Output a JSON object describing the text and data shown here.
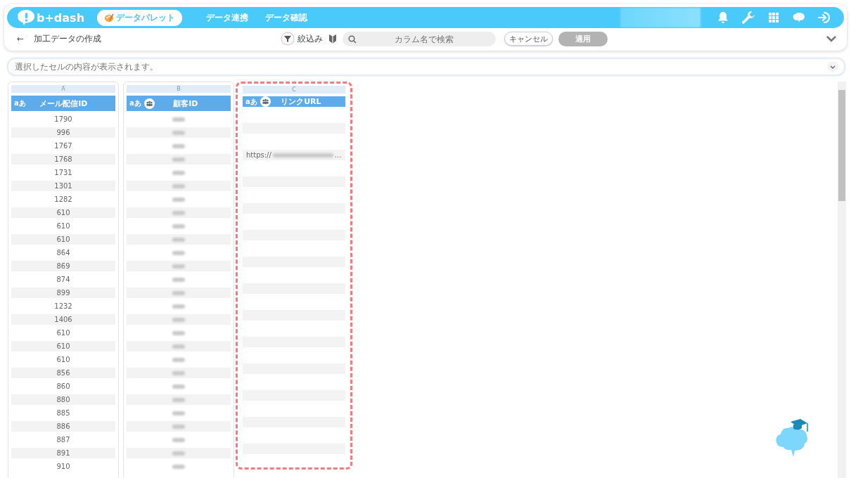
{
  "header": {
    "logo": "b+dash",
    "tabs": [
      {
        "label": "データパレット",
        "selected": true
      },
      {
        "label": "データ連携",
        "selected": false
      },
      {
        "label": "データ確認",
        "selected": false
      }
    ]
  },
  "toolbar": {
    "back": "←",
    "title": "加工データの作成",
    "filter_label": "絞込み",
    "search": {
      "placeholder": "カラム名で検索"
    },
    "cancel": "キャンセル",
    "apply": {
      "label": "適用",
      "disabled": true
    }
  },
  "cell_bar": {
    "placeholder": "選択したセルの内容が表示されます。"
  },
  "columns": [
    {
      "letter": "A",
      "title": "メール配信ID",
      "type_label": "aあ",
      "grouped": false,
      "highlighted": false
    },
    {
      "letter": "B",
      "title": "顧客ID",
      "type_label": "aあ",
      "grouped": true,
      "highlighted": false
    },
    {
      "letter": "C",
      "title": "リンクURL",
      "type_label": "aあ",
      "grouped": true,
      "highlighted": true
    }
  ],
  "rows": [
    {
      "mail_id": "1790"
    },
    {
      "mail_id": "996"
    },
    {
      "mail_id": "1767"
    },
    {
      "mail_id": "1768",
      "link": "https://",
      "link_more": "..."
    },
    {
      "mail_id": "1731"
    },
    {
      "mail_id": "1301"
    },
    {
      "mail_id": "1282"
    },
    {
      "mail_id": "610"
    },
    {
      "mail_id": "610"
    },
    {
      "mail_id": "610"
    },
    {
      "mail_id": "864"
    },
    {
      "mail_id": "869"
    },
    {
      "mail_id": "874"
    },
    {
      "mail_id": "899"
    },
    {
      "mail_id": "1232"
    },
    {
      "mail_id": "1406"
    },
    {
      "mail_id": "610"
    },
    {
      "mail_id": "610"
    },
    {
      "mail_id": "610"
    },
    {
      "mail_id": "856"
    },
    {
      "mail_id": "860"
    },
    {
      "mail_id": "880"
    },
    {
      "mail_id": "885"
    },
    {
      "mail_id": "886"
    },
    {
      "mail_id": "887"
    },
    {
      "mail_id": "891"
    },
    {
      "mail_id": "910"
    }
  ]
}
